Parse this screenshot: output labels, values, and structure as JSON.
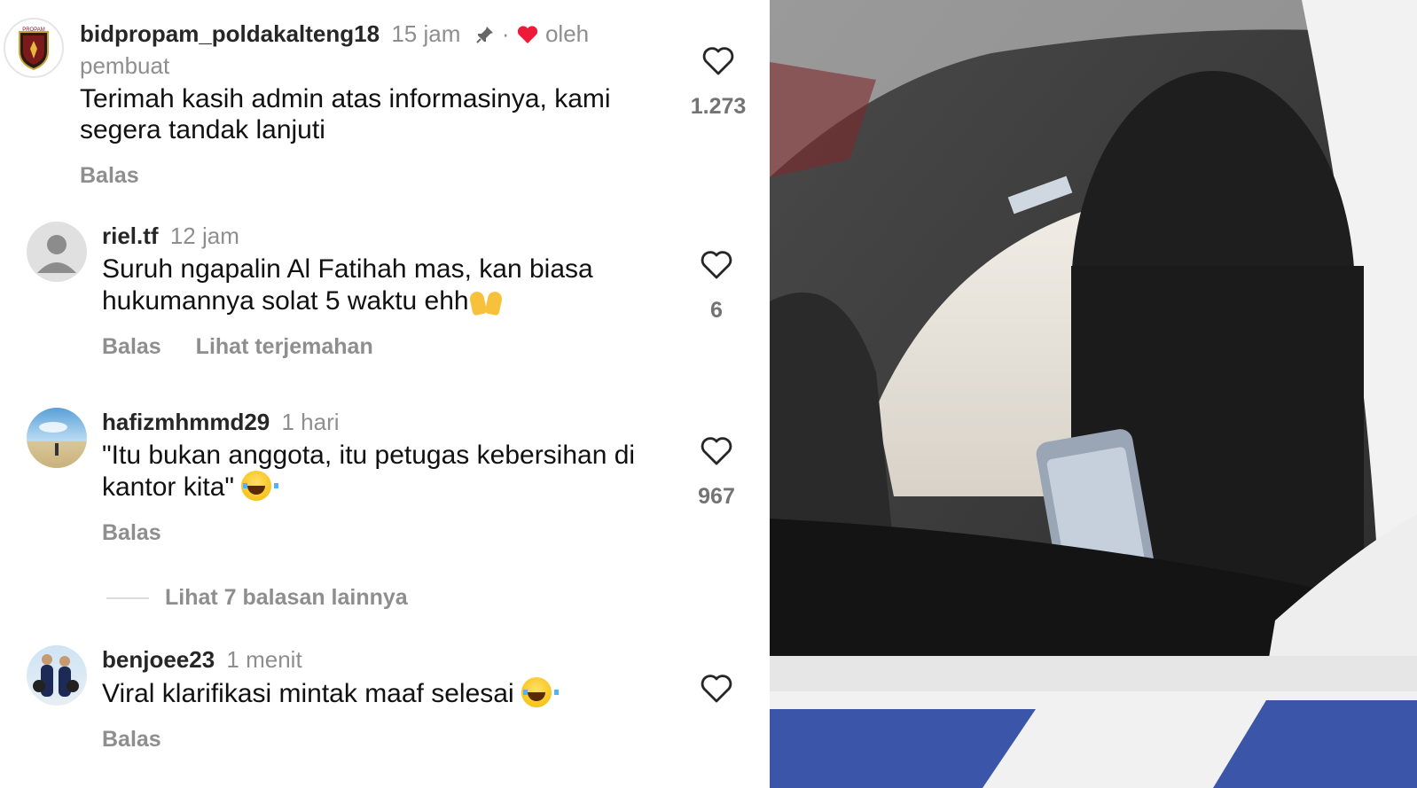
{
  "comments": [
    {
      "username": "bidpropam_poldakalteng18",
      "time": "15 jam",
      "dot": "·",
      "by_label": "oleh",
      "by_label2": "pembuat",
      "text_line1": "Terimah kasih admin atas informasinya, kami",
      "text_line2": "segera tandak lanjuti",
      "reply": "Balas",
      "likes": "1.273",
      "avatar_text": "PROPAM"
    },
    {
      "username": "riel.tf",
      "time": "12 jam",
      "text_line1": "Suruh ngapalin Al Fatihah mas, kan biasa",
      "text_line2": "hukumannya solat 5 waktu ehh",
      "reply": "Balas",
      "translate": "Lihat terjemahan",
      "likes": "6"
    },
    {
      "username": "hafizmhmmd29",
      "time": "1 hari",
      "text_line1": "\"Itu bukan anggota, itu petugas kebersihan di",
      "text_line2": "kantor kita\"",
      "reply": "Balas",
      "likes": "967"
    },
    {
      "username": "benjoee23",
      "time": "1 menit",
      "text_line1": "Viral klarifikasi mintak maaf selesai",
      "reply": "Balas"
    }
  ],
  "more_replies": "Lihat 7 balasan lainnya",
  "icons": [
    "pin-icon",
    "heart-filled-icon",
    "heart-outline-icon",
    "default-avatar-icon"
  ],
  "colors": {
    "heart_red": "#ed1a3a",
    "muted": "#8e8e8e"
  }
}
